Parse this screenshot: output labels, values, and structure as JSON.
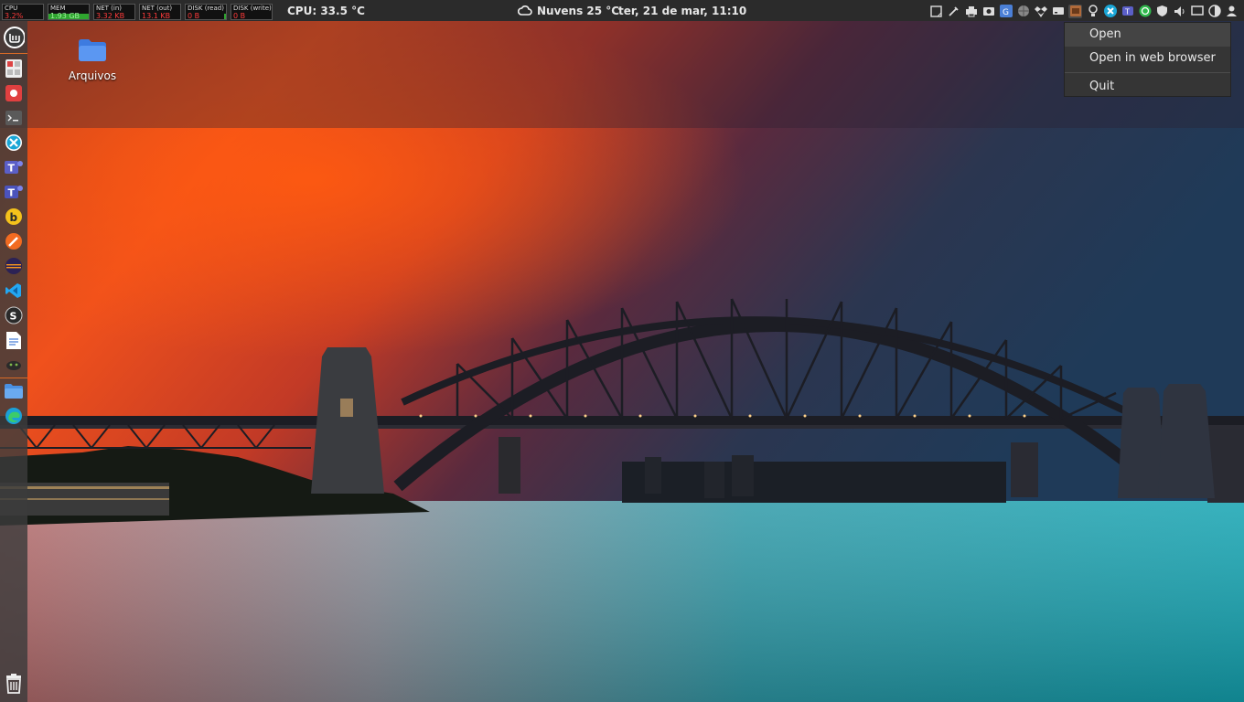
{
  "panel": {
    "monitors": [
      {
        "label": "CPU",
        "value": "3.2%"
      },
      {
        "label": "MEM",
        "value": "1.93 GB"
      },
      {
        "label": "NET (in)",
        "value": "3.32 KB"
      },
      {
        "label": "NET (out)",
        "value": "13.1 KB"
      },
      {
        "label": "DISK (read)",
        "value": "0 B"
      },
      {
        "label": "DISK (write)",
        "value": "0 B"
      }
    ],
    "cpu_temp": "CPU: 33.5 °C",
    "weather": "Nuvens 25 °C",
    "clock": "ter, 21 de mar, 11:10",
    "tray_icons": [
      "notes-icon",
      "color-picker-icon",
      "printer-icon",
      "screenshot-icon",
      "translate-icon",
      "network-globe-icon",
      "dropbox-icon",
      "drive-icon",
      "app-indicator-icon",
      "lightbulb-icon",
      "anydesk-icon",
      "teams-icon",
      "whatsapp-icon",
      "shield-icon",
      "volume-icon",
      "display-icon",
      "night-light-icon",
      "user-icon"
    ]
  },
  "dock": {
    "items": [
      "mint-menu-icon",
      "calculator-icon",
      "screen-recorder-icon",
      "terminal-icon",
      "anydesk-icon",
      "teams-icon",
      "teams-classic-icon",
      "beekeeper-icon",
      "pencil-icon",
      "eclipse-icon",
      "vscode-icon",
      "sublime-icon",
      "document-icon",
      "gnome-icon",
      "files-icon",
      "edge-icon",
      "trash-icon"
    ]
  },
  "desktop": {
    "icons": [
      {
        "label": "Arquivos",
        "icon": "folder-icon"
      }
    ]
  },
  "context_menu": {
    "items": [
      "Open",
      "Open in web browser",
      "Quit"
    ]
  },
  "colors": {
    "panel_bg": "#2b2b2b",
    "accent": "#d96a26",
    "menu_bg": "#353535"
  }
}
